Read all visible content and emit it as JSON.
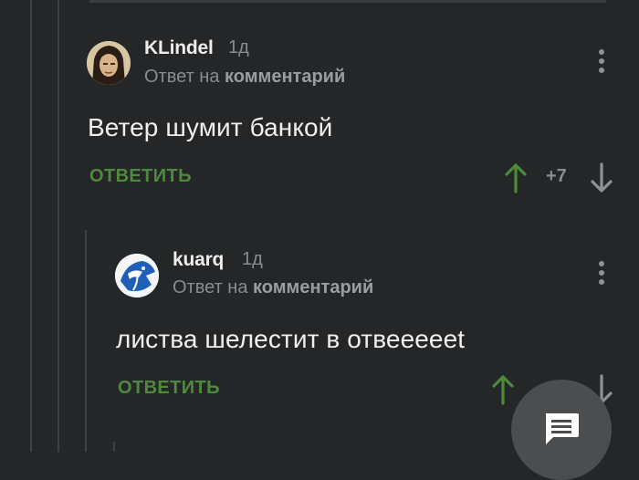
{
  "comments": [
    {
      "author": "KLindel",
      "age": "1д",
      "reply_prefix": "Ответ на",
      "reply_target": "комментарий",
      "text": "Ветер шумит банкой",
      "reply_label": "ОТВЕТИТЬ",
      "score": "+7"
    },
    {
      "author": "kuarq",
      "age": "1д",
      "reply_prefix": "Ответ на",
      "reply_target": "комментарий",
      "text": "листва шелестит в отвеееееt",
      "reply_label": "ОТВЕТИТЬ"
    }
  ],
  "icons": {
    "more": "more-vertical-icon",
    "upvote": "arrow-up-icon",
    "downvote": "arrow-down-icon",
    "comments_fab": "chat-icon"
  },
  "colors": {
    "background": "#242628",
    "reply_green": "#4e8a3c",
    "muted": "#8a8c8e"
  }
}
